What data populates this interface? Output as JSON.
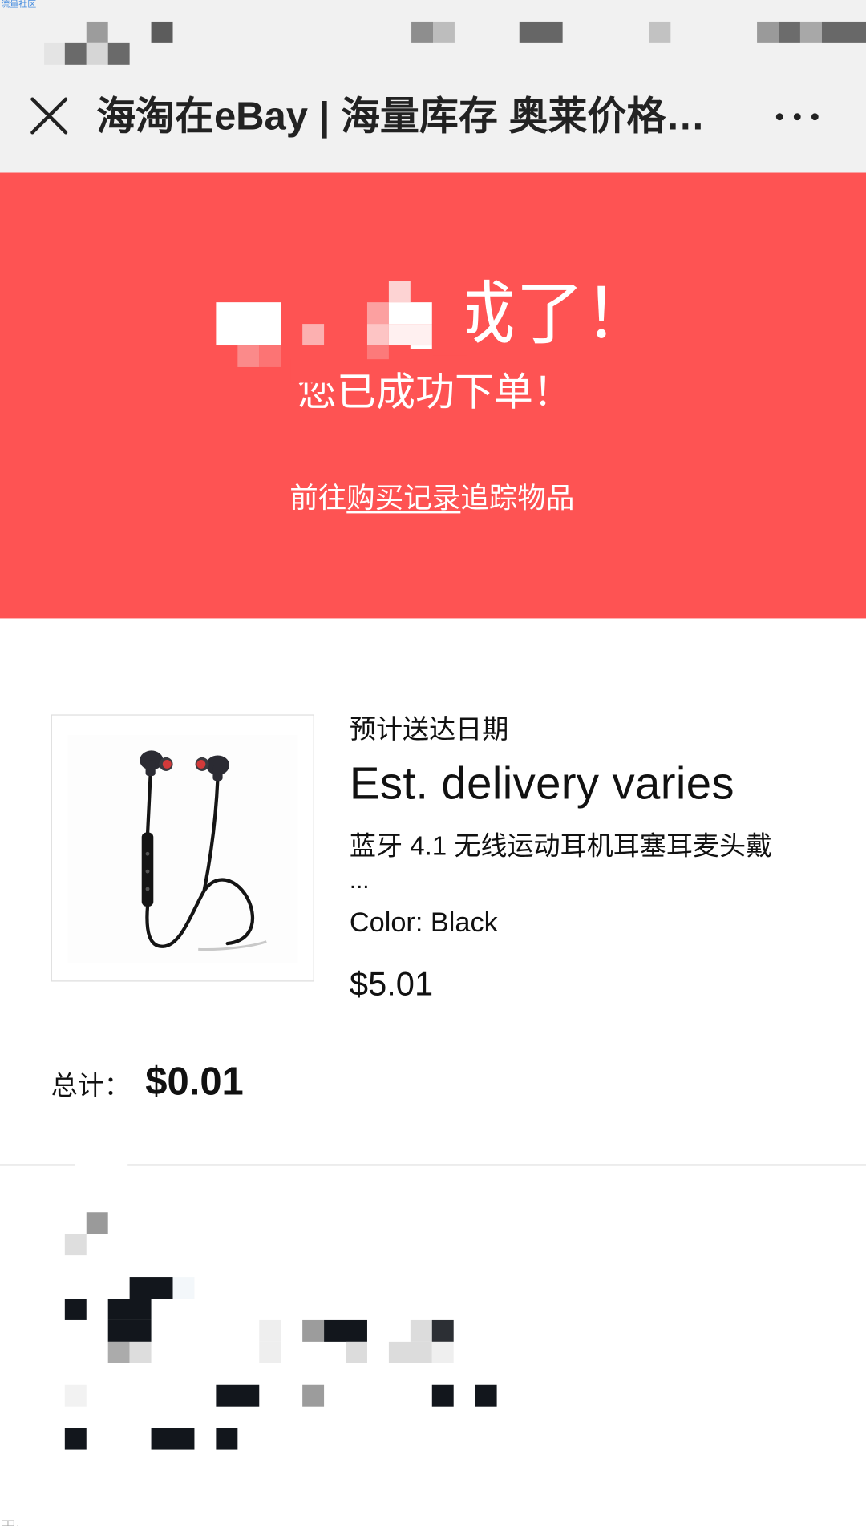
{
  "watermark": "流量社区",
  "title_bar": {
    "title": "海淘在eBay | 海量库存 奥莱价格…",
    "close_icon": "close-icon",
    "more_icon": "more-icon"
  },
  "banner": {
    "background": "#fe5353",
    "heading": "成了！",
    "subheading": "您已成功下单！",
    "track_prefix": "前往",
    "track_link": "购买记录",
    "track_suffix": "追踪物品"
  },
  "order": {
    "delivery_label": "预计送达日期",
    "delivery_value": "Est. delivery varies",
    "item": {
      "image_icon": "earphones-image",
      "title": "蓝牙 4.1 无线运动耳机耳塞耳麦头戴",
      "title_overflow": "...",
      "variant": "Color: Black",
      "price": "$5.01"
    },
    "total_label": "总计：",
    "total_value": "$0.01"
  },
  "footer_glyphs": "□□ ."
}
